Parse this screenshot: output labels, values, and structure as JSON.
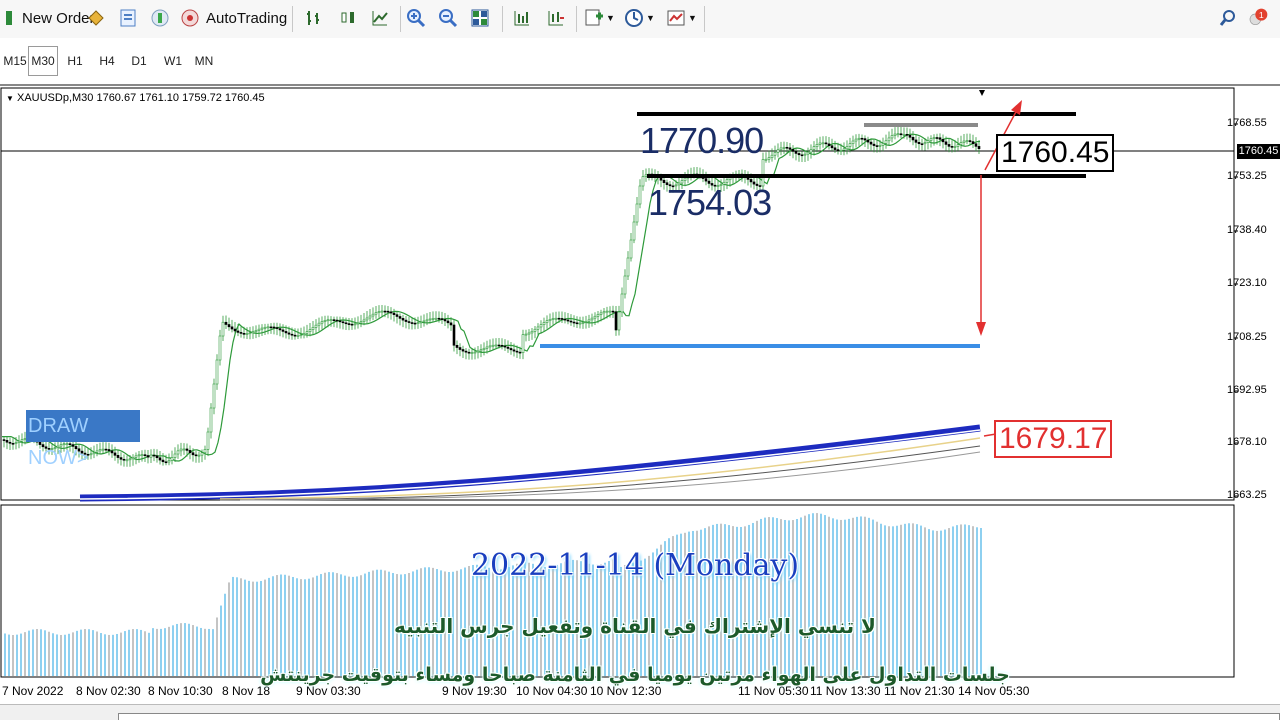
{
  "toolbar": {
    "new_order_label": "New Order",
    "autotrading_label": "AutoTrading"
  },
  "timeframes": [
    "M15",
    "M30",
    "H1",
    "H4",
    "D1",
    "W1",
    "MN"
  ],
  "active_timeframe": "M30",
  "chart": {
    "symbol_info": "XAUUSDp,M30  1760.67 1761.10 1759.72 1760.45",
    "current_price": "1760.45",
    "price_axis": [
      "1768.55",
      "1753.25",
      "1738.40",
      "1723.10",
      "1708.25",
      "1692.95",
      "1678.10",
      "1663.25"
    ],
    "time_axis": [
      "7 Nov 2022",
      "8 Nov 02:30",
      "8 Nov 10:30",
      "8 Nov 18",
      "9 Nov 03:30",
      "9 Nov 19:30",
      "10 Nov 04:30",
      "10 Nov 12:30",
      "11 Nov 05:30",
      "11 Nov 13:30",
      "11 Nov 21:30",
      "14 Nov 05:30"
    ],
    "annotations": {
      "resistance": "1770.90",
      "support": "1754.03",
      "current_box": "1760.45",
      "ma_box": "1679.17",
      "draw_now": "DRAW NOW>"
    }
  },
  "overlay": {
    "date": "2022-11-14 (Monday)",
    "line1": "لا تنسي الإشتراك في القناة وتفعيل جرس التنبيه",
    "line2": "جلسات التداول على الهواء مرتين يوميا في الثامنة صباحا ومساء بتوقيت جرينتش"
  },
  "colors": {
    "ma_blue": "#1d2bbf",
    "highlight_line": "#3a8ee6",
    "arrow_red": "#e23030",
    "candle_green": "#2e9a3a",
    "volume_blue": "#8ed0f0",
    "volume_gray": "#c4c4c4"
  },
  "icons": [
    "new-order-icon",
    "metaeditor-icon",
    "navigator-icon",
    "market-watch-icon",
    "autotrading-icon",
    "bar-chart-icon",
    "candle-chart-icon",
    "line-chart-icon",
    "zoom-in-icon",
    "zoom-out-icon",
    "tile-icon",
    "autoscroll-icon",
    "chart-shift-icon",
    "indicators-icon",
    "periods-icon",
    "templates-icon",
    "search-icon",
    "notification-icon"
  ]
}
